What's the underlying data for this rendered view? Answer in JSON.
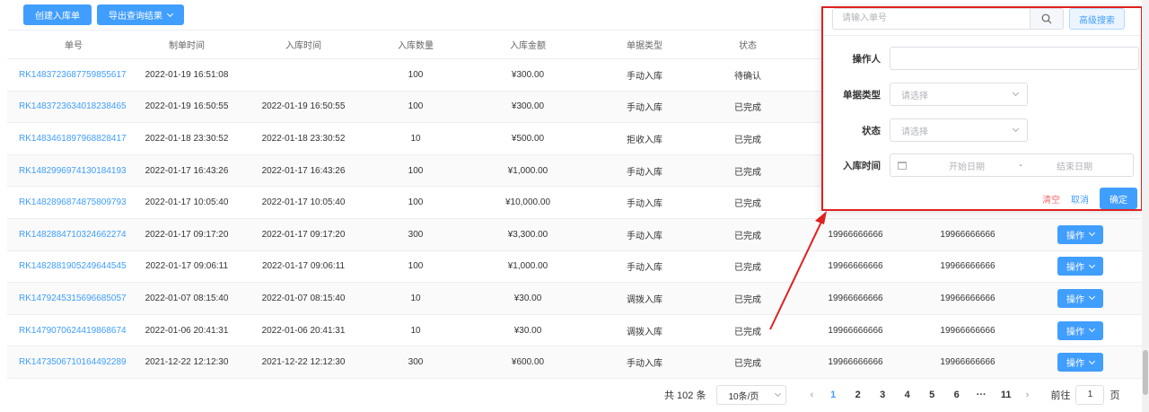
{
  "toolbar": {
    "create_label": "创建入库单",
    "export_label": "导出查询结果"
  },
  "table": {
    "headers": [
      "单号",
      "制单时间",
      "入库时间",
      "入库数量",
      "入库金额",
      "单据类型",
      "状态",
      "",
      "",
      ""
    ],
    "rows": [
      {
        "no": "RK1483723687759855617",
        "created": "2022-01-19 16:51:08",
        "in_time": "",
        "qty": "100",
        "amount": "¥300.00",
        "type": "手动入库",
        "status": "待确认",
        "op1": "",
        "op2": "",
        "has_btn": false
      },
      {
        "no": "RK1483723634018238465",
        "created": "2022-01-19 16:50:55",
        "in_time": "2022-01-19 16:50:55",
        "qty": "100",
        "amount": "¥300.00",
        "type": "手动入库",
        "status": "已完成",
        "op1": "",
        "op2": "",
        "has_btn": false
      },
      {
        "no": "RK1483461897968828417",
        "created": "2022-01-18 23:30:52",
        "in_time": "2022-01-18 23:30:52",
        "qty": "10",
        "amount": "¥500.00",
        "type": "拒收入库",
        "status": "已完成",
        "op1": "",
        "op2": "",
        "has_btn": false
      },
      {
        "no": "RK1482996974130184193",
        "created": "2022-01-17 16:43:26",
        "in_time": "2022-01-17 16:43:26",
        "qty": "100",
        "amount": "¥1,000.00",
        "type": "手动入库",
        "status": "已完成",
        "op1": "",
        "op2": "",
        "has_btn": false
      },
      {
        "no": "RK1482896874875809793",
        "created": "2022-01-17 10:05:40",
        "in_time": "2022-01-17 10:05:40",
        "qty": "100",
        "amount": "¥10,000.00",
        "type": "手动入库",
        "status": "已完成",
        "op1": "",
        "op2": "",
        "has_btn": false
      },
      {
        "no": "RK1482884710324662274",
        "created": "2022-01-17 09:17:20",
        "in_time": "2022-01-17 09:17:20",
        "qty": "300",
        "amount": "¥3,300.00",
        "type": "手动入库",
        "status": "已完成",
        "op1": "19966666666",
        "op2": "19966666666",
        "has_btn": true
      },
      {
        "no": "RK1482881905249644545",
        "created": "2022-01-17 09:06:11",
        "in_time": "2022-01-17 09:06:11",
        "qty": "100",
        "amount": "¥1,000.00",
        "type": "手动入库",
        "status": "已完成",
        "op1": "19966666666",
        "op2": "19966666666",
        "has_btn": true
      },
      {
        "no": "RK1479245315696685057",
        "created": "2022-01-07 08:15:40",
        "in_time": "2022-01-07 08:15:40",
        "qty": "10",
        "amount": "¥30.00",
        "type": "调拨入库",
        "status": "已完成",
        "op1": "19966666666",
        "op2": "19966666666",
        "has_btn": true
      },
      {
        "no": "RK1479070624419868674",
        "created": "2022-01-06 20:41:31",
        "in_time": "2022-01-06 20:41:31",
        "qty": "10",
        "amount": "¥30.00",
        "type": "调拨入库",
        "status": "已完成",
        "op1": "19966666666",
        "op2": "19966666666",
        "has_btn": true
      },
      {
        "no": "RK1473506710164492289",
        "created": "2021-12-22 12:12:30",
        "in_time": "2021-12-22 12:12:30",
        "qty": "300",
        "amount": "¥600.00",
        "type": "手动入库",
        "status": "已完成",
        "op1": "19966666666",
        "op2": "19966666666",
        "has_btn": true
      }
    ],
    "op_label": "操作"
  },
  "pagination": {
    "total": "共 102 条",
    "page_size": "10条/页",
    "pages": [
      "1",
      "2",
      "3",
      "4",
      "5",
      "6",
      "···",
      "11"
    ],
    "active_page": "1",
    "prev": "‹",
    "next": "›",
    "goto_prefix": "前往",
    "goto_value": "1",
    "goto_suffix": "页"
  },
  "search": {
    "placeholder": "请输入单号",
    "advanced_label": "高级搜索",
    "operator_label": "操作人",
    "doc_type_label": "单据类型",
    "doc_type_placeholder": "请选择",
    "status_label": "状态",
    "status_placeholder": "请选择",
    "in_time_label": "入库时间",
    "start_placeholder": "开始日期",
    "range_sep": "-",
    "end_placeholder": "结束日期",
    "clear_label": "清空",
    "cancel_label": "取消",
    "ok_label": "确定"
  },
  "colors": {
    "primary": "#409eff",
    "highlight_border": "#e02020",
    "danger": "#f56c6c"
  }
}
